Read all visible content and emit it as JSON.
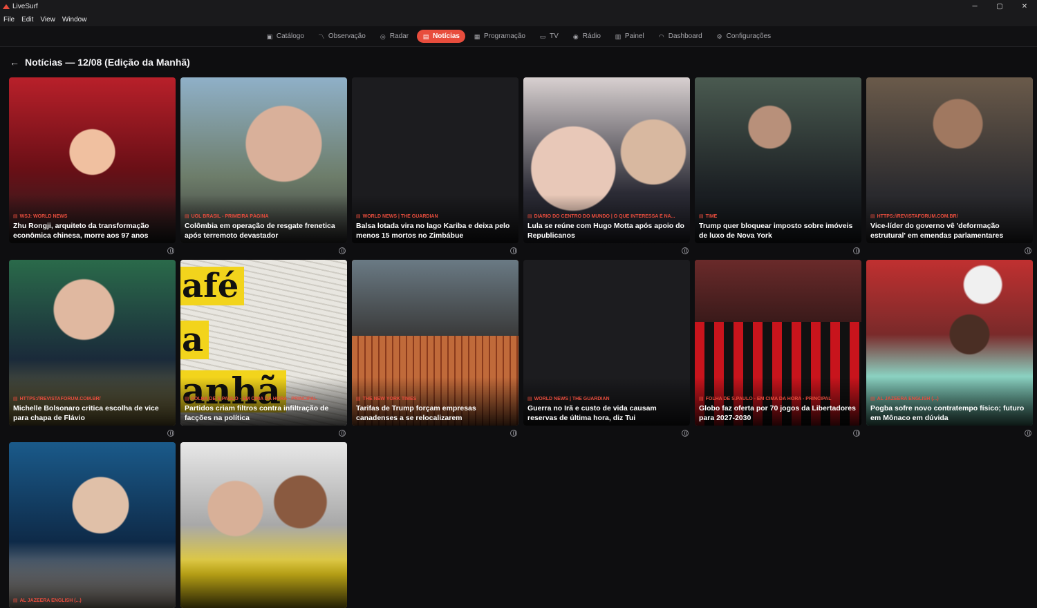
{
  "window": {
    "title": "LiveSurf",
    "controls": [
      "─",
      "▢",
      "✕"
    ]
  },
  "menu": [
    "File",
    "Edit",
    "View",
    "Window"
  ],
  "nav": [
    {
      "label": "Catálogo",
      "icon": "catalog-icon",
      "glyph": "▣",
      "active": false
    },
    {
      "label": "Observação",
      "icon": "observation-icon",
      "glyph": "〽",
      "active": false
    },
    {
      "label": "Radar",
      "icon": "radar-icon",
      "glyph": "◎",
      "active": false
    },
    {
      "label": "Notícias",
      "icon": "news-icon",
      "glyph": "▤",
      "active": true
    },
    {
      "label": "Programação",
      "icon": "calendar-icon",
      "glyph": "▦",
      "active": false
    },
    {
      "label": "TV",
      "icon": "tv-icon",
      "glyph": "▭",
      "active": false
    },
    {
      "label": "Rádio",
      "icon": "radio-icon",
      "glyph": "◉",
      "active": false
    },
    {
      "label": "Painel",
      "icon": "panel-icon",
      "glyph": "▥",
      "active": false
    },
    {
      "label": "Dashboard",
      "icon": "dashboard-icon",
      "glyph": "◠",
      "active": false
    },
    {
      "label": "Configurações",
      "icon": "gear-icon",
      "glyph": "⚙",
      "active": false
    }
  ],
  "page": {
    "title": "Notícias — 12/08 (Edição da Manhã)"
  },
  "colors": {
    "accent": "#e84d3d",
    "background": "#0e0e10",
    "card": "#18181b"
  },
  "cards": [
    {
      "source": "WSJ: World News",
      "headline": "Zhu Rongji, arquiteto da transformação econômica chinesa, morre aos 97 anos",
      "image": "bg-red"
    },
    {
      "source": "UOL Brasil - Primeira Página",
      "headline": "Colômbia em operação de resgate frenetica após terremoto devastador",
      "image": "bg-crowd"
    },
    {
      "source": "World news | The Guardian",
      "headline": "Balsa lotada vira no lago Kariba e deixa pelo menos 15 mortos no Zimbábue",
      "image": "bg-empty"
    },
    {
      "source": "Diário do Centro do Mundo | O que interessa é na...",
      "headline": "Lula se reúne com Hugo Motta após apoio do Republicanos",
      "image": "bg-lula"
    },
    {
      "source": "TIME",
      "headline": "Trump quer bloquear imposto sobre imóveis de luxo de Nova York",
      "image": "bg-trump"
    },
    {
      "source": "https://revistaforum.com.br/",
      "headline": "Vice-líder do governo vê 'deformação estrutural' em emendas parlamentares",
      "image": "bg-forum"
    },
    {
      "source": "https://revistaforum.com.br/",
      "headline": "Michelle Bolsonaro critica escolha de vice para chapa de Flávio",
      "image": "bg-mich"
    },
    {
      "source": "Folha de S.Paulo - Em cima da hora - Principal",
      "headline": "Partidos criam filtros contra infiltração de facções na política",
      "image": "bg-news"
    },
    {
      "source": "The New York Times",
      "headline": "Tarifas de Trump forçam empresas canadenses a se relocalizarem",
      "image": "bg-copper"
    },
    {
      "source": "World news | The Guardian",
      "headline": "Guerra no Irã e custo de vida causam reservas de última hora, diz Tui",
      "image": "bg-empty"
    },
    {
      "source": "Folha de S.Paulo - Em cima da hora - Principal",
      "headline": "Globo faz oferta por 70 jogos da Libertadores para 2027-2030",
      "image": "bg-fla"
    },
    {
      "source": "Al Jazeera English (...)",
      "headline": "Pogba sofre novo contratempo físico; futuro em Mônaco em dúvida",
      "image": "bg-pogba"
    },
    {
      "source": "Al Jazeera English (...)",
      "headline": "",
      "image": "bg-tennis"
    },
    {
      "source": "",
      "headline": "",
      "image": "bg-fico"
    }
  ],
  "newspaper_lettering": [
    "afé",
    "a",
    "anhã"
  ]
}
